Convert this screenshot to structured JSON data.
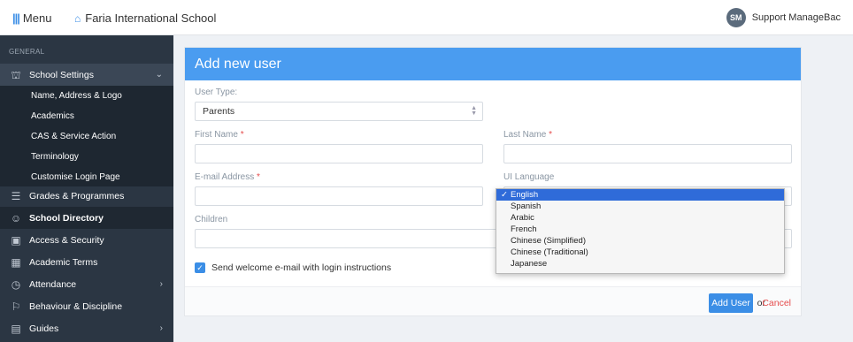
{
  "topbar": {
    "menu_label": "Menu",
    "school_name": "Faria International School",
    "user_initials": "SM",
    "user_name": "Support ManageBac"
  },
  "sidebar": {
    "section": "GENERAL",
    "school_settings": "School Settings",
    "sub_items": [
      "Name, Address & Logo",
      "Academics",
      "CAS & Service Action",
      "Terminology",
      "Customise Login Page"
    ],
    "grades": "Grades & Programmes",
    "directory": "School Directory",
    "access": "Access & Security",
    "terms": "Academic Terms",
    "attendance": "Attendance",
    "behaviour": "Behaviour & Discipline",
    "guides": "Guides"
  },
  "form": {
    "title": "Add new user",
    "user_type_label": "User Type:",
    "user_type_value": "Parents",
    "first_name_label": "First Name",
    "last_name_label": "Last Name",
    "required_mark": "*",
    "email_label": "E-mail Address",
    "ui_language_label": "UI Language",
    "children_label": "Children",
    "welcome_checkbox": "Send welcome e-mail with login instructions",
    "add_button": "Add User",
    "or_text": "or",
    "cancel": "Cancel"
  },
  "language_dropdown": {
    "selected": "English",
    "options": [
      "English",
      "Spanish",
      "Arabic",
      "French",
      "Chinese (Simplified)",
      "Chinese (Traditional)",
      "Japanese"
    ]
  },
  "colors": {
    "header_blue": "#4a9cf0",
    "sidebar_bg": "#2b3643",
    "cancel_red": "#e54b4b"
  }
}
